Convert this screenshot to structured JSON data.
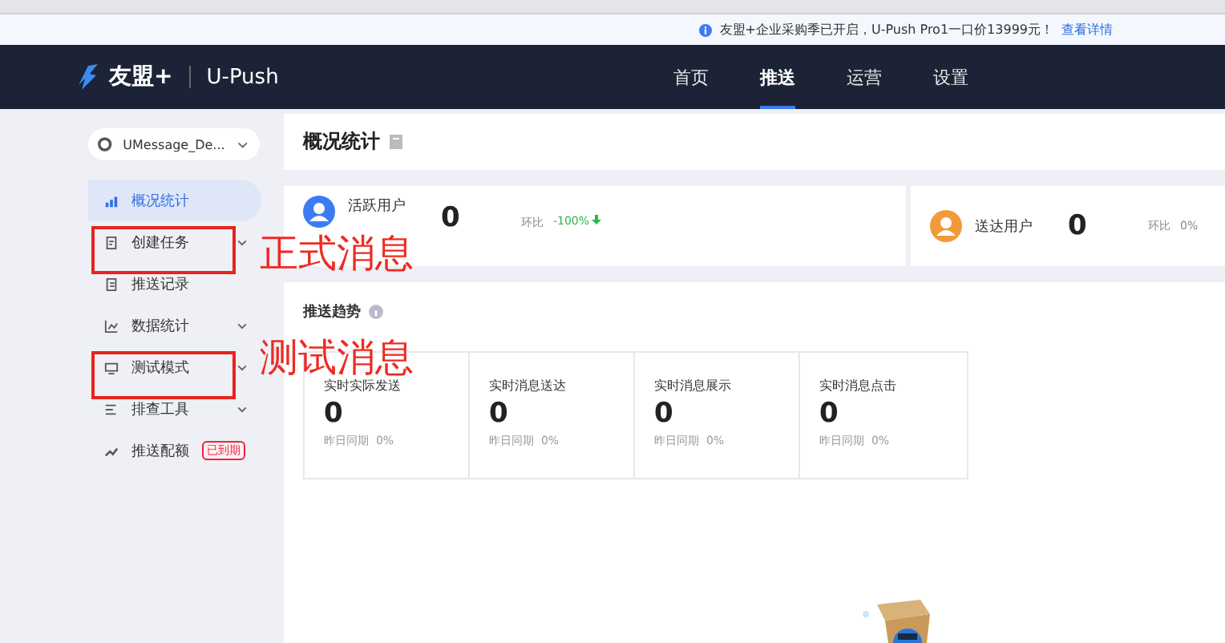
{
  "notice": {
    "text": "友盟+企业采购季已开启，U-Push Pro1一口价13999元！",
    "link": "查看详情"
  },
  "header": {
    "brand": "友盟+",
    "product": "U-Push",
    "nav": [
      {
        "label": "首页",
        "selected": false
      },
      {
        "label": "推送",
        "selected": true
      },
      {
        "label": "运营",
        "selected": false
      },
      {
        "label": "设置",
        "selected": false
      }
    ]
  },
  "sidebar": {
    "app_selector": "UMessage_De...",
    "items": [
      {
        "label": "概况统计",
        "selected": true,
        "expandable": false
      },
      {
        "label": "创建任务",
        "selected": false,
        "expandable": true,
        "annotation": "正式消息"
      },
      {
        "label": "推送记录",
        "selected": false,
        "expandable": false
      },
      {
        "label": "数据统计",
        "selected": false,
        "expandable": true
      },
      {
        "label": "测试模式",
        "selected": false,
        "expandable": true,
        "annotation": "测试消息"
      },
      {
        "label": "排查工具",
        "selected": false,
        "expandable": true
      },
      {
        "label": "推送配额",
        "selected": false,
        "expandable": false,
        "badge": "已到期"
      }
    ]
  },
  "page_title": "概况统计",
  "stats": [
    {
      "label": "活跃用户",
      "value": "0",
      "compare_label": "环比",
      "change": "-100%",
      "decreased": true,
      "color": "#3b7cf0"
    },
    {
      "label": "送达用户",
      "value": "0",
      "compare_label": "环比",
      "change": "0%",
      "decreased": false,
      "color": "#f29a38"
    }
  ],
  "trend": {
    "title": "推送趋势",
    "cards": [
      {
        "title": "实时实际发送",
        "value": "0",
        "compare_label": "昨日同期",
        "change": "0%"
      },
      {
        "title": "实时消息送达",
        "value": "0",
        "compare_label": "昨日同期",
        "change": "0%"
      },
      {
        "title": "实时消息展示",
        "value": "0",
        "compare_label": "昨日同期",
        "change": "0%"
      },
      {
        "title": "实时消息点击",
        "value": "0",
        "compare_label": "昨日同期",
        "change": "0%"
      }
    ]
  }
}
